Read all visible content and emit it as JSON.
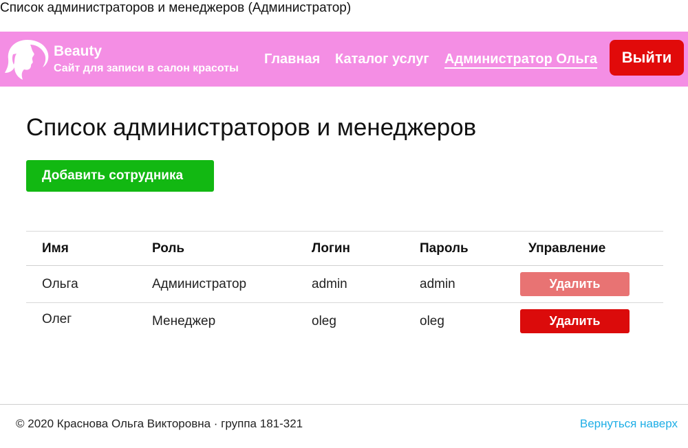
{
  "window": {
    "caption": "Список администраторов и менеджеров (Администратор)"
  },
  "colors": {
    "navbar": "#f48ee4",
    "logout": "#e10a0a",
    "add": "#12b812",
    "delete": "#db0b0b",
    "delete_faded": "#e87373",
    "link": "#1eaee6"
  },
  "header": {
    "logo_icon": "woman-profile-icon",
    "brand_name": "Beauty",
    "brand_tagline": "Сайт для записи в салон красоты",
    "nav": [
      {
        "label": "Главная",
        "active": false
      },
      {
        "label": "Каталог услуг",
        "active": false
      },
      {
        "label": "Администратор Ольга",
        "active": true
      }
    ],
    "logout_label": "Выйти"
  },
  "main": {
    "title": "Список администраторов и менеджеров",
    "add_button": "Добавить сотрудника",
    "table": {
      "columns": [
        "Имя",
        "Роль",
        "Логин",
        "Пароль",
        "Управление"
      ],
      "rows": [
        {
          "name": "Ольга",
          "role": "Администратор",
          "login": "admin",
          "password": "admin",
          "action": "Удалить"
        },
        {
          "name": "Олег",
          "role": "Менеджер",
          "login": "oleg",
          "password": "oleg",
          "action": "Удалить"
        }
      ]
    }
  },
  "footer": {
    "copyright": "© 2020 Краснова Ольга Викторовна · группа 181-321",
    "back_to_top": "Вернуться наверх"
  }
}
